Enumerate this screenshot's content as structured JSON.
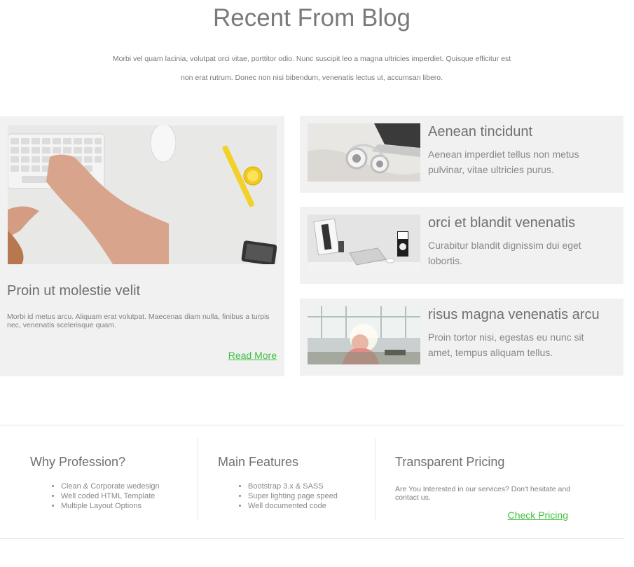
{
  "blog": {
    "title": "Recent From Blog",
    "intro_line1": "Morbi vel quam lacinia, volutpat orci vitae, porttitor odio. Nunc suscipit leo a magna ultricies imperdiet. Quisque efficitur est",
    "intro_line2": "non erat rutrum. Donec non nisi bibendum, venenatis lectus ut, accumsan libero."
  },
  "featured": {
    "image": "keyboard-hands-photo",
    "title": "Proin ut molestie velit",
    "text": "Morbi id metus arcu. Aliquam erat volutpat. Maecenas diam nulla, finibus a turpis nec, venenatis scelerisque quam.",
    "read_more": "Read More"
  },
  "posts": [
    {
      "image": "headphones-laptop-photo",
      "title": "Aenean tincidunt",
      "text": "Aenean imperdiet tellus non metus pulvinar, vitae ultricies purus."
    },
    {
      "image": "desk-laptop-photo",
      "title": "orci et blandit venenatis",
      "text": "Curabitur blandit dignissim dui eget lobortis."
    },
    {
      "image": "office-window-photo",
      "title": "risus magna venenatis arcu",
      "text": "Proin tortor nisi, egestas eu nunc sit amet, tempus aliquam tellus."
    }
  ],
  "footer": {
    "why": {
      "heading": "Why Profession?",
      "items": [
        "Clean & Corporate wedesign",
        "Well coded HTML Template",
        "Multiple Layout Options"
      ]
    },
    "features": {
      "heading": "Main Features",
      "items": [
        "Bootstrap 3.x & SASS",
        "Super lighting page speed",
        "Well documented code"
      ]
    },
    "pricing": {
      "heading": "Transparent Pricing",
      "text": "Are You Interested in our services? Don't hesitate and contact us.",
      "link": "Check Pricing"
    }
  },
  "colors": {
    "link": "#3fbf3f",
    "card_bg": "#f1f1f1",
    "heading": "#707070"
  }
}
